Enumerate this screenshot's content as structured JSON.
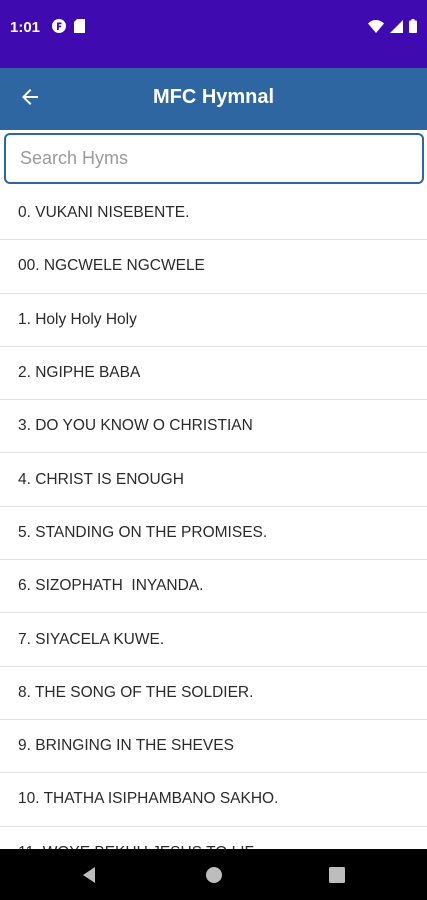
{
  "status_bar": {
    "time": "1:01",
    "icons": [
      "notification-f-icon",
      "sd-card-icon",
      "wifi-icon",
      "signal-icon",
      "battery-icon"
    ]
  },
  "app_bar": {
    "title": "MFC Hymnal",
    "back_icon": "arrow-back-icon",
    "color": "#2e66a1"
  },
  "search": {
    "placeholder": "Search Hyms",
    "value": ""
  },
  "hymns": [
    "0. VUKANI NISEBENTE.",
    "00. NGCWELE NGCWELE",
    "1. Holy Holy Holy",
    "2. NGIPHE BABA",
    "3. DO YOU KNOW O CHRISTIAN",
    "4. CHRIST IS ENOUGH",
    "5. STANDING ON THE PROMISES.",
    "6. SIZOPHATH  INYANDA.",
    "7. SIYACELA KUWE.",
    "8. THE SONG OF THE SOLDIER.",
    "9. BRINGING IN THE SHEVES",
    "10. THATHA ISIPHAMBANO SAKHO.",
    "11. WOYE BEKHU JESUS TO LIF"
  ],
  "colors": {
    "status_bar": "#3f0ab0",
    "app_bar": "#2e66a1",
    "nav_bar": "#000000"
  }
}
